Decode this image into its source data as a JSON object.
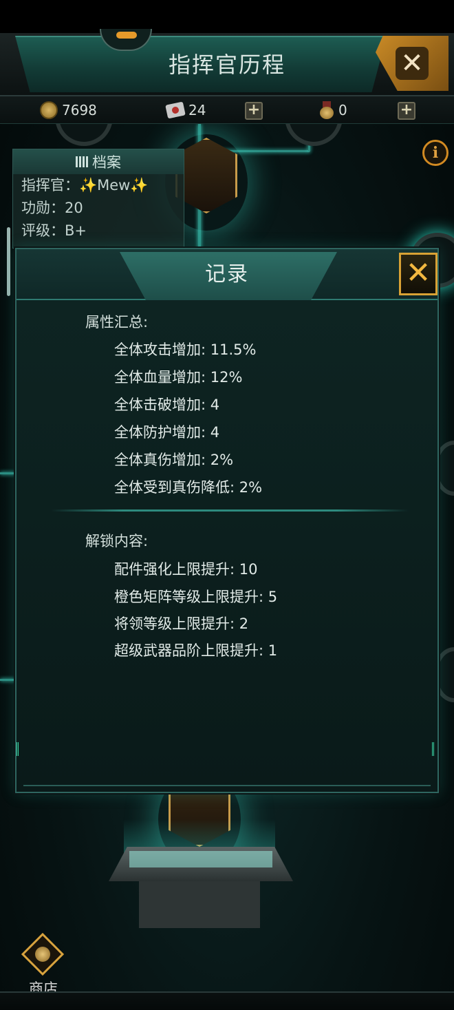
{
  "header": {
    "title": "指挥官历程"
  },
  "currency": {
    "coins": "7698",
    "tickets": "24",
    "medals": "0"
  },
  "profile": {
    "title": "档案",
    "commander": "指挥官：✨Mew✨",
    "merit": "功勋：20",
    "rating": "评级：B+"
  },
  "modal": {
    "title": "记录",
    "close_label": "✕",
    "attributes_title": "属性汇总:",
    "attributes": [
      "全体攻击增加: 11.5%",
      "全体血量增加: 12%",
      "全体击破增加: 4",
      "全体防护增加: 4",
      "全体真伤增加: 2%",
      "全体受到真伤降低: 2%"
    ],
    "unlocks_title": "解锁内容:",
    "unlocks": [
      "配件强化上限提升: 10",
      "橙色矩阵等级上限提升: 5",
      "将领等级上限提升: 2",
      "超级武器品阶上限提升: 1"
    ]
  },
  "header_close_label": "✕",
  "plus_label": "+",
  "info_label": "i",
  "shop": {
    "label": "商店"
  }
}
